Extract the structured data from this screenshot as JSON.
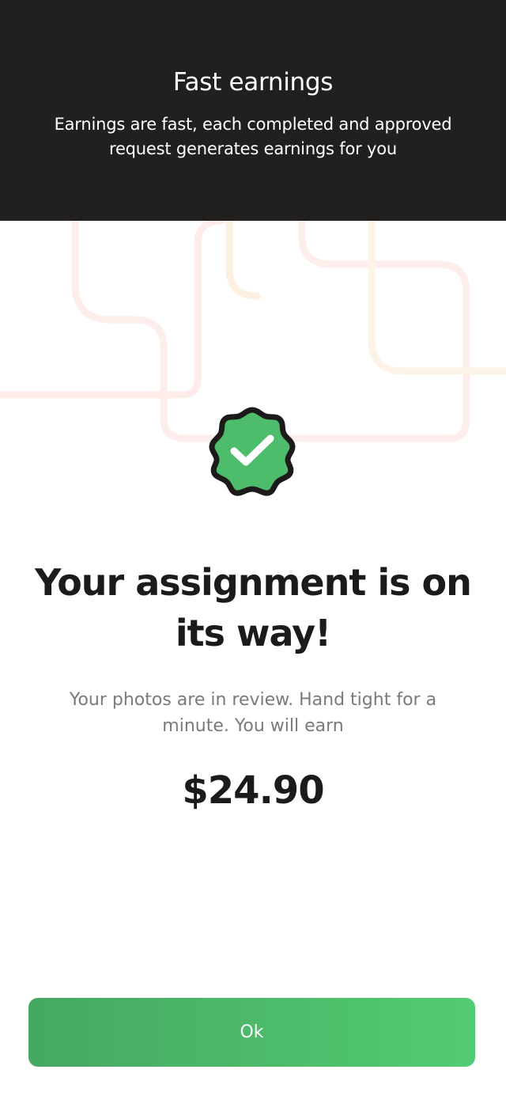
{
  "header": {
    "title": "Fast earnings",
    "subtitle": "Earnings are fast, each completed and approved request generates earnings for you"
  },
  "content": {
    "headline": "Your assignment is on its way!",
    "description": "Your photos are in review. Hand tight for a minute. You will earn",
    "amount": "$24.90"
  },
  "actions": {
    "ok_label": "Ok"
  },
  "icons": {
    "badge": "verified-check-badge-icon"
  },
  "colors": {
    "header_background": "#221f1f",
    "badge_green": "#4dbd6b",
    "button_green_start": "#45a861",
    "button_green_end": "#52cc72",
    "decor_pink": "#fdecea",
    "decor_peach": "#fdf0e3"
  }
}
